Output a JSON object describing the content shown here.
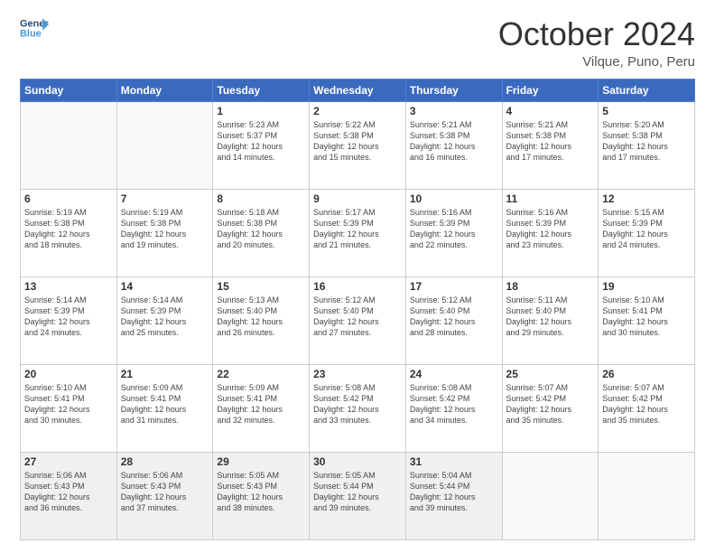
{
  "logo": {
    "line1": "General",
    "line2": "Blue"
  },
  "header": {
    "month": "October 2024",
    "location": "Vilque, Puno, Peru"
  },
  "weekdays": [
    "Sunday",
    "Monday",
    "Tuesday",
    "Wednesday",
    "Thursday",
    "Friday",
    "Saturday"
  ],
  "weeks": [
    [
      {
        "day": "",
        "info": ""
      },
      {
        "day": "",
        "info": ""
      },
      {
        "day": "1",
        "info": "Sunrise: 5:23 AM\nSunset: 5:37 PM\nDaylight: 12 hours\nand 14 minutes."
      },
      {
        "day": "2",
        "info": "Sunrise: 5:22 AM\nSunset: 5:38 PM\nDaylight: 12 hours\nand 15 minutes."
      },
      {
        "day": "3",
        "info": "Sunrise: 5:21 AM\nSunset: 5:38 PM\nDaylight: 12 hours\nand 16 minutes."
      },
      {
        "day": "4",
        "info": "Sunrise: 5:21 AM\nSunset: 5:38 PM\nDaylight: 12 hours\nand 17 minutes."
      },
      {
        "day": "5",
        "info": "Sunrise: 5:20 AM\nSunset: 5:38 PM\nDaylight: 12 hours\nand 17 minutes."
      }
    ],
    [
      {
        "day": "6",
        "info": "Sunrise: 5:19 AM\nSunset: 5:38 PM\nDaylight: 12 hours\nand 18 minutes."
      },
      {
        "day": "7",
        "info": "Sunrise: 5:19 AM\nSunset: 5:38 PM\nDaylight: 12 hours\nand 19 minutes."
      },
      {
        "day": "8",
        "info": "Sunrise: 5:18 AM\nSunset: 5:38 PM\nDaylight: 12 hours\nand 20 minutes."
      },
      {
        "day": "9",
        "info": "Sunrise: 5:17 AM\nSunset: 5:39 PM\nDaylight: 12 hours\nand 21 minutes."
      },
      {
        "day": "10",
        "info": "Sunrise: 5:16 AM\nSunset: 5:39 PM\nDaylight: 12 hours\nand 22 minutes."
      },
      {
        "day": "11",
        "info": "Sunrise: 5:16 AM\nSunset: 5:39 PM\nDaylight: 12 hours\nand 23 minutes."
      },
      {
        "day": "12",
        "info": "Sunrise: 5:15 AM\nSunset: 5:39 PM\nDaylight: 12 hours\nand 24 minutes."
      }
    ],
    [
      {
        "day": "13",
        "info": "Sunrise: 5:14 AM\nSunset: 5:39 PM\nDaylight: 12 hours\nand 24 minutes."
      },
      {
        "day": "14",
        "info": "Sunrise: 5:14 AM\nSunset: 5:39 PM\nDaylight: 12 hours\nand 25 minutes."
      },
      {
        "day": "15",
        "info": "Sunrise: 5:13 AM\nSunset: 5:40 PM\nDaylight: 12 hours\nand 26 minutes."
      },
      {
        "day": "16",
        "info": "Sunrise: 5:12 AM\nSunset: 5:40 PM\nDaylight: 12 hours\nand 27 minutes."
      },
      {
        "day": "17",
        "info": "Sunrise: 5:12 AM\nSunset: 5:40 PM\nDaylight: 12 hours\nand 28 minutes."
      },
      {
        "day": "18",
        "info": "Sunrise: 5:11 AM\nSunset: 5:40 PM\nDaylight: 12 hours\nand 29 minutes."
      },
      {
        "day": "19",
        "info": "Sunrise: 5:10 AM\nSunset: 5:41 PM\nDaylight: 12 hours\nand 30 minutes."
      }
    ],
    [
      {
        "day": "20",
        "info": "Sunrise: 5:10 AM\nSunset: 5:41 PM\nDaylight: 12 hours\nand 30 minutes."
      },
      {
        "day": "21",
        "info": "Sunrise: 5:09 AM\nSunset: 5:41 PM\nDaylight: 12 hours\nand 31 minutes."
      },
      {
        "day": "22",
        "info": "Sunrise: 5:09 AM\nSunset: 5:41 PM\nDaylight: 12 hours\nand 32 minutes."
      },
      {
        "day": "23",
        "info": "Sunrise: 5:08 AM\nSunset: 5:42 PM\nDaylight: 12 hours\nand 33 minutes."
      },
      {
        "day": "24",
        "info": "Sunrise: 5:08 AM\nSunset: 5:42 PM\nDaylight: 12 hours\nand 34 minutes."
      },
      {
        "day": "25",
        "info": "Sunrise: 5:07 AM\nSunset: 5:42 PM\nDaylight: 12 hours\nand 35 minutes."
      },
      {
        "day": "26",
        "info": "Sunrise: 5:07 AM\nSunset: 5:42 PM\nDaylight: 12 hours\nand 35 minutes."
      }
    ],
    [
      {
        "day": "27",
        "info": "Sunrise: 5:06 AM\nSunset: 5:43 PM\nDaylight: 12 hours\nand 36 minutes."
      },
      {
        "day": "28",
        "info": "Sunrise: 5:06 AM\nSunset: 5:43 PM\nDaylight: 12 hours\nand 37 minutes."
      },
      {
        "day": "29",
        "info": "Sunrise: 5:05 AM\nSunset: 5:43 PM\nDaylight: 12 hours\nand 38 minutes."
      },
      {
        "day": "30",
        "info": "Sunrise: 5:05 AM\nSunset: 5:44 PM\nDaylight: 12 hours\nand 39 minutes."
      },
      {
        "day": "31",
        "info": "Sunrise: 5:04 AM\nSunset: 5:44 PM\nDaylight: 12 hours\nand 39 minutes."
      },
      {
        "day": "",
        "info": ""
      },
      {
        "day": "",
        "info": ""
      }
    ]
  ]
}
